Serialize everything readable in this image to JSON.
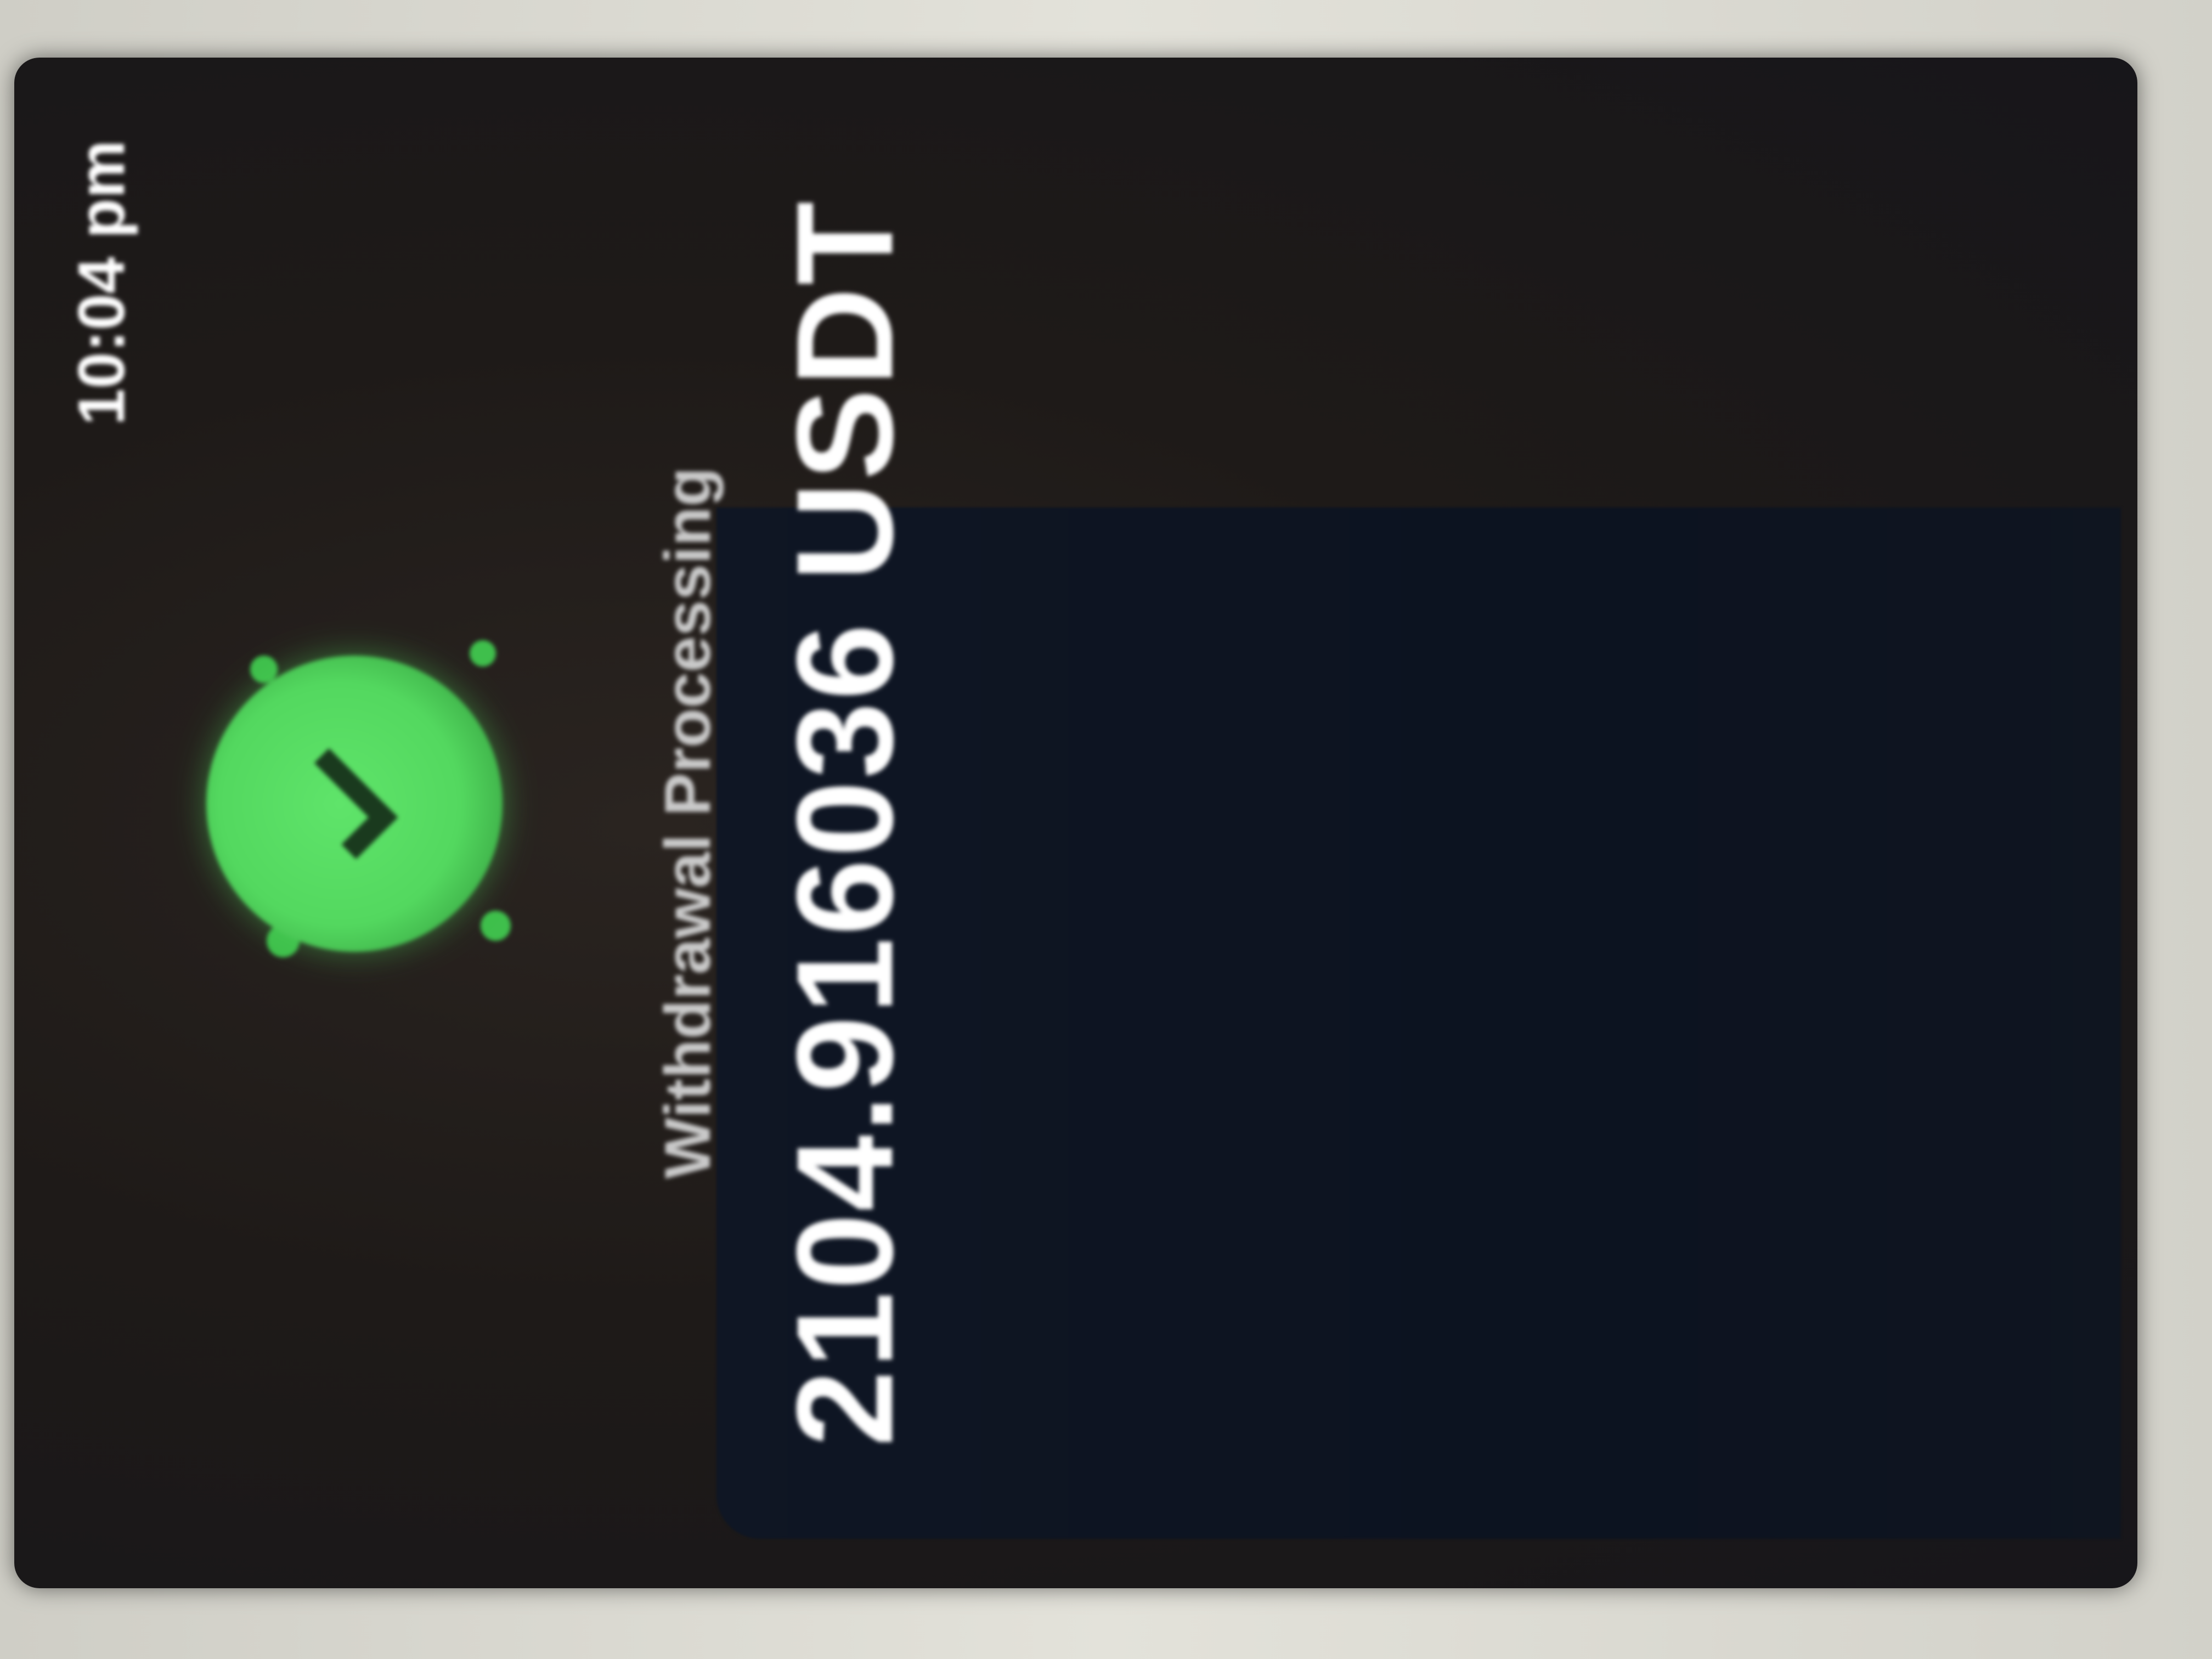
{
  "status_bar": {
    "time": "10:04 pm"
  },
  "withdrawal": {
    "icon": "check-circle-icon",
    "status_text": "Withdrawal Processing",
    "amount": "2104.916036 USDT"
  },
  "colors": {
    "success_green": "#53d85f",
    "background": "#1e1a18",
    "text_primary": "#ffffff",
    "text_secondary": "#c9c9c9"
  }
}
